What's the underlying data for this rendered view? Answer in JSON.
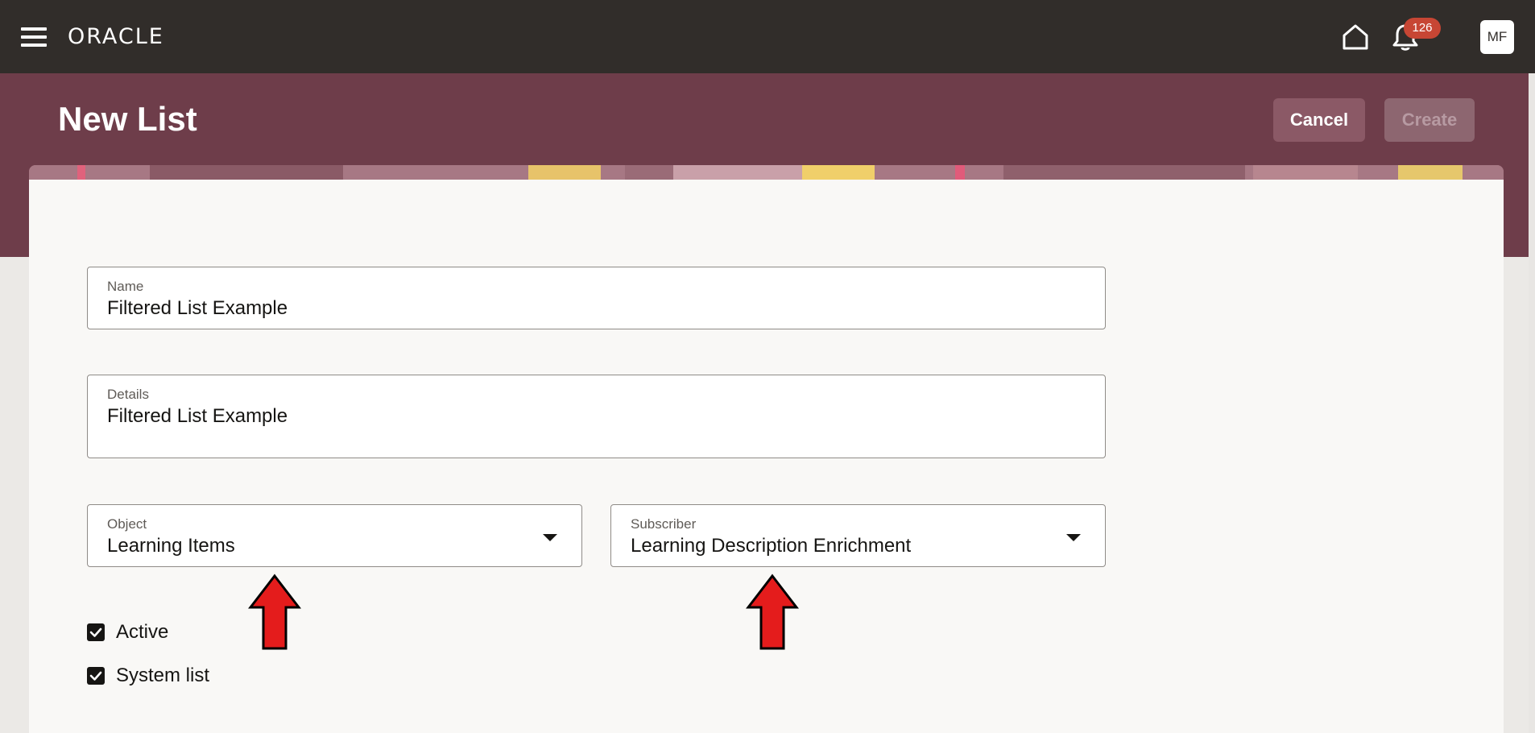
{
  "header": {
    "brand": "ORACLE",
    "notification_count": "126",
    "avatar_initials": "MF",
    "icons": [
      "hamburger-menu-icon",
      "home-icon",
      "bell-icon"
    ]
  },
  "page": {
    "title": "New List",
    "cancel_label": "Cancel",
    "create_label": "Create",
    "create_enabled": false
  },
  "form": {
    "name": {
      "label": "Name",
      "value": "Filtered List Example"
    },
    "details": {
      "label": "Details",
      "value": "Filtered List Example"
    },
    "object": {
      "label": "Object",
      "value": "Learning Items"
    },
    "subscriber": {
      "label": "Subscriber",
      "value": "Learning Description Enrichment"
    },
    "active": {
      "label": "Active",
      "checked": true
    },
    "system_list": {
      "label": "System list",
      "checked": true
    }
  },
  "colors": {
    "topbar": "#312d2a",
    "banner": "#6e3d4a",
    "badge": "#c74634",
    "annotation_arrow": "#e41c1c"
  }
}
